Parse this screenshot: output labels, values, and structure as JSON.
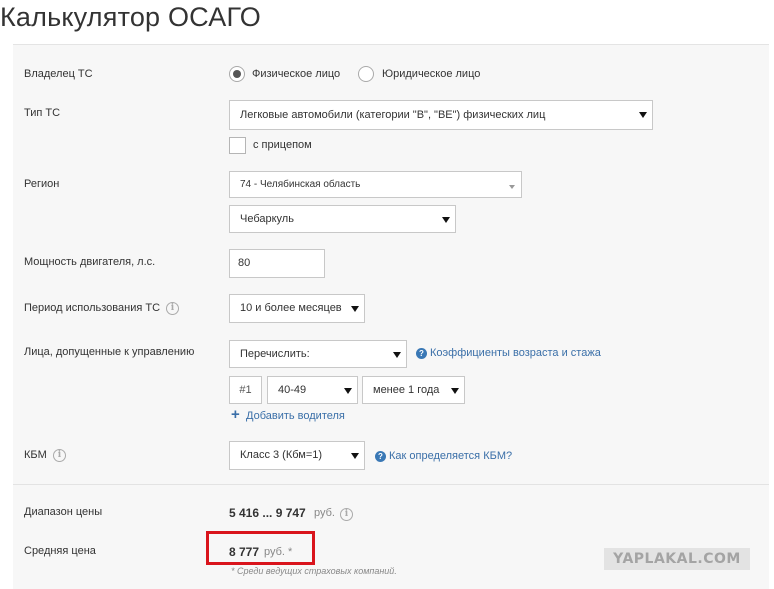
{
  "page": {
    "title": "Калькулятор ОСАГО"
  },
  "owner": {
    "label": "Владелец ТС",
    "options": [
      "Физическое лицо",
      "Юридическое лицо"
    ],
    "selected": "Физическое лицо"
  },
  "vehicle_type": {
    "label": "Тип ТС",
    "value": "Легковые автомобили (категории \"B\", \"BE\") физических лиц",
    "trailer_label": "с прицепом",
    "trailer_checked": false
  },
  "region": {
    "label": "Регион",
    "value": "74 - Челябинская область",
    "city": "Чебаркуль"
  },
  "engine_power": {
    "label": "Мощность двигателя, л.с.",
    "value": "80"
  },
  "usage_period": {
    "label": "Период использования ТС",
    "value": "10 и более месяцев"
  },
  "drivers": {
    "label": "Лица, допущенные к управлению",
    "mode": "Перечислить:",
    "coeff_link": "Коэффициенты возраста и стажа",
    "list": [
      {
        "number": "#1",
        "age": "40-49",
        "experience": "менее 1 года"
      }
    ],
    "add_label": "Добавить водителя"
  },
  "kbm": {
    "label": "КБМ",
    "value": "Класс 3 (Кбм=1)",
    "help_link": "Как определяется КБМ?"
  },
  "results": {
    "range_label": "Диапазон цены",
    "range_value": "5 416 ... 9 747",
    "range_unit": "руб.",
    "avg_label": "Средняя цена",
    "avg_value": "8 777",
    "avg_unit": "руб. *",
    "footnote": "* Среди ведущих страховых компаний."
  },
  "watermark": "YAPLAKAL.COM",
  "colors": {
    "link": "#3a6fa8",
    "highlight": "#d9141c",
    "panel": "#f7f7f7"
  }
}
